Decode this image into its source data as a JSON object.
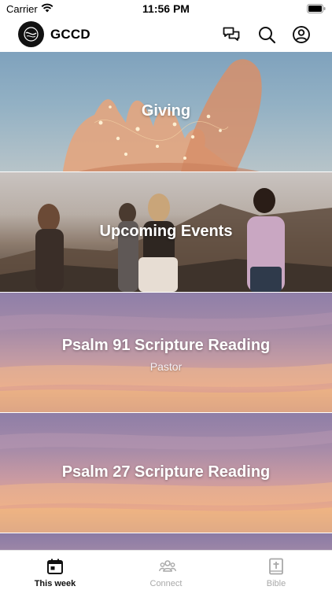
{
  "status_bar": {
    "carrier": "Carrier",
    "time": "11:56 PM"
  },
  "header": {
    "title": "GCCD",
    "icons": [
      "logo-icon",
      "chat-icon",
      "search-icon",
      "profile-icon"
    ]
  },
  "feed": {
    "cards": [
      {
        "title": "Giving",
        "subtitle": ""
      },
      {
        "title": "Upcoming Events",
        "subtitle": ""
      },
      {
        "title": "Psalm 91 Scripture Reading",
        "subtitle": "Pastor"
      },
      {
        "title": "Psalm 27 Scripture Reading",
        "subtitle": ""
      }
    ]
  },
  "tab_bar": {
    "tabs": [
      {
        "label": "This week",
        "icon": "calendar-icon",
        "active": true
      },
      {
        "label": "Connect",
        "icon": "people-icon",
        "active": false
      },
      {
        "label": "Bible",
        "icon": "bible-icon",
        "active": false
      }
    ]
  },
  "colors": {
    "accent": "#111111",
    "inactive_tab": "#a9a9a9"
  }
}
